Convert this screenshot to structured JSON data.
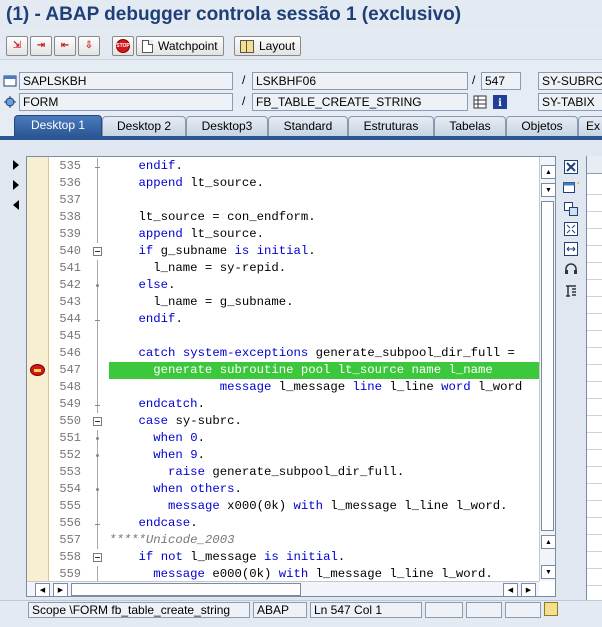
{
  "window": {
    "title": "(1) - ABAP debugger controla sessão 1 (exclusivo)"
  },
  "toolbar": {
    "step_into_icon": "step-into-icon",
    "step_over_icon": "step-over-icon",
    "step_return_icon": "step-return-icon",
    "continue_icon": "continue-icon",
    "stop_label": "STOP",
    "watchpoint_label": "Watchpoint",
    "layout_label": "Layout"
  },
  "fields": {
    "program": "SAPLSKBH",
    "include": "LSKBHF06",
    "line": "547",
    "sy_subrc_label": "SY-SUBRC",
    "event_type": "FORM",
    "event_name": "FB_TABLE_CREATE_STRING",
    "sy_tabix_label": "SY-TABIX",
    "separator": "/"
  },
  "tabs": [
    {
      "label": "Desktop 1",
      "active": true
    },
    {
      "label": "Desktop 2"
    },
    {
      "label": "Desktop3"
    },
    {
      "label": "Standard"
    },
    {
      "label": "Estruturas"
    },
    {
      "label": "Tabelas"
    },
    {
      "label": "Objetos"
    },
    {
      "label": "Ex"
    }
  ],
  "code": {
    "lines": [
      {
        "n": "535",
        "text": "    endif."
      },
      {
        "n": "536",
        "text": "    append lt_source."
      },
      {
        "n": "537",
        "text": ""
      },
      {
        "n": "538",
        "text": "    lt_source = con_endform."
      },
      {
        "n": "539",
        "text": "    append lt_source."
      },
      {
        "n": "540",
        "text": "    if g_subname is initial."
      },
      {
        "n": "541",
        "text": "      l_name = sy-repid."
      },
      {
        "n": "542",
        "text": "    else."
      },
      {
        "n": "543",
        "text": "      l_name = g_subname."
      },
      {
        "n": "544",
        "text": "    endif."
      },
      {
        "n": "545",
        "text": ""
      },
      {
        "n": "546",
        "text": "    catch system-exceptions generate_subpool_dir_full ="
      },
      {
        "n": "547",
        "text": "      generate subroutine pool lt_source name l_name"
      },
      {
        "n": "548",
        "text": "               message l_message line l_line word l_word"
      },
      {
        "n": "549",
        "text": "    endcatch."
      },
      {
        "n": "550",
        "text": "    case sy-subrc."
      },
      {
        "n": "551",
        "text": "      when 0."
      },
      {
        "n": "552",
        "text": "      when 9."
      },
      {
        "n": "553",
        "text": "        raise generate_subpool_dir_full."
      },
      {
        "n": "554",
        "text": "      when others."
      },
      {
        "n": "555",
        "text": "        message x000(0k) with l_message l_line l_word."
      },
      {
        "n": "556",
        "text": "    endcase."
      },
      {
        "n": "557",
        "text": "*****Unicode_2003"
      },
      {
        "n": "558",
        "text": "    if not l_message is initial."
      },
      {
        "n": "559",
        "text": "      message e000(0k) with l_message l_line l_word."
      }
    ]
  },
  "status": {
    "scope": "Scope \\FORM fb_table_create_string",
    "language": "ABAP",
    "position": "Ln 547 Col   1"
  }
}
